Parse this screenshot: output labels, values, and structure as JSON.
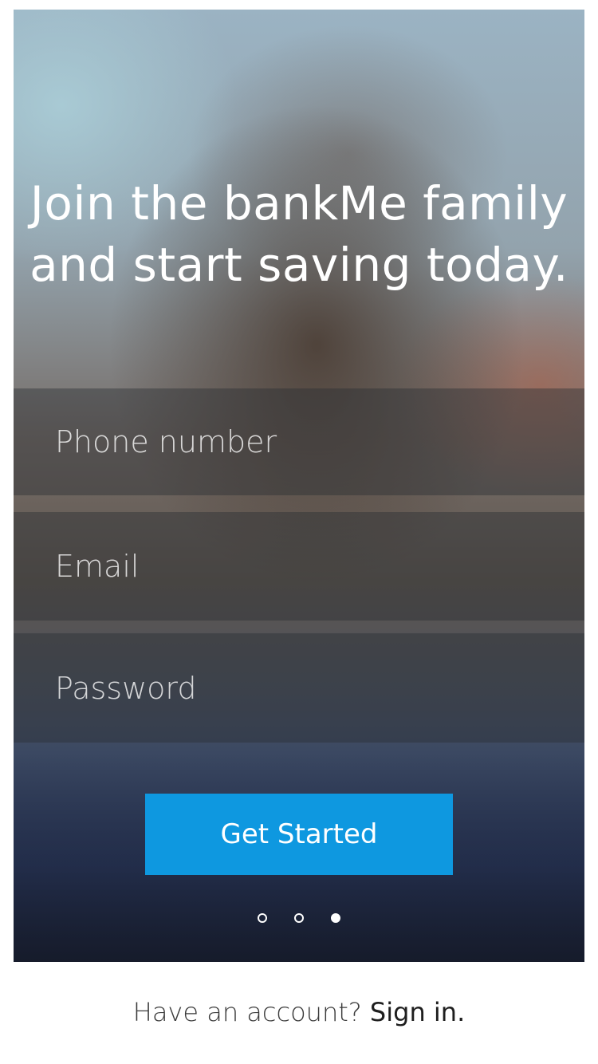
{
  "hero": {
    "headline": "Join the bankMe family and start saving today."
  },
  "form": {
    "phone_placeholder": "Phone number",
    "email_placeholder": "Email",
    "password_placeholder": "Password",
    "submit_label": "Get Started"
  },
  "pager": {
    "total": 3,
    "active_index": 2
  },
  "footer": {
    "prompt": "Have an account?",
    "signin_label": "Sign in."
  },
  "colors": {
    "accent": "#0e98e0",
    "text_on_dark": "#ffffff"
  }
}
